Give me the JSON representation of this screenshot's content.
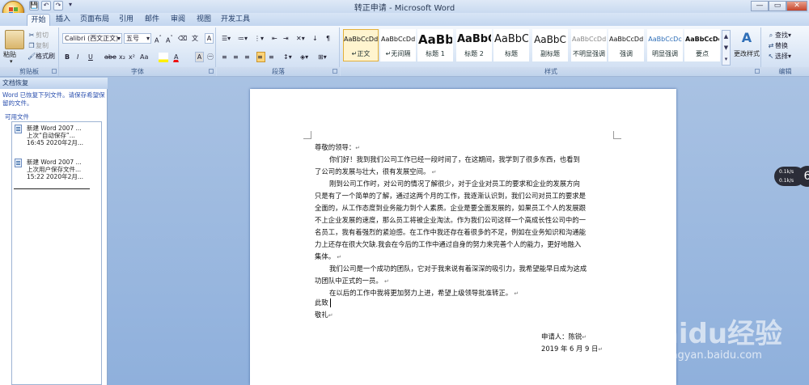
{
  "window": {
    "title": "转正申请 - Microsoft Word",
    "min": "—",
    "max": "▭",
    "close": "✕"
  },
  "qat": [
    "💾",
    "↶",
    "↷",
    "▾"
  ],
  "tabs": [
    "开始",
    "插入",
    "页面布局",
    "引用",
    "邮件",
    "审阅",
    "视图",
    "开发工具"
  ],
  "clipboard": {
    "paste": "粘贴",
    "cut": "剪切",
    "copy": "复制",
    "format_painter": "格式刷",
    "label": "剪贴板"
  },
  "font": {
    "name": "Calibri (西文正文)",
    "size": "五号",
    "label": "字体",
    "buttons": [
      "B",
      "I",
      "U",
      "abe",
      "x₂",
      "x²",
      "Aa",
      "A",
      "A"
    ]
  },
  "paragraph": {
    "label": "段落"
  },
  "styles": {
    "label": "样式",
    "items": [
      {
        "preview": "AaBbCcDd",
        "name": "↵正文",
        "size": "8px",
        "bold": false,
        "color": "#111"
      },
      {
        "preview": "AaBbCcDd",
        "name": "↵无间隔",
        "size": "8px",
        "bold": false,
        "color": "#111"
      },
      {
        "preview": "AaBb",
        "name": "标题 1",
        "size": "15px",
        "bold": true,
        "color": "#111"
      },
      {
        "preview": "AaBbC",
        "name": "标题 2",
        "size": "13px",
        "bold": true,
        "color": "#111"
      },
      {
        "preview": "AaBbC",
        "name": "标题",
        "size": "13px",
        "bold": false,
        "color": "#111"
      },
      {
        "preview": "AaBbC",
        "name": "副标题",
        "size": "12px",
        "bold": false,
        "color": "#111"
      },
      {
        "preview": "AaBbCcDd",
        "name": "不明显强调",
        "size": "8px",
        "bold": false,
        "color": "#888"
      },
      {
        "preview": "AaBbCcDd",
        "name": "强调",
        "size": "8px",
        "bold": false,
        "color": "#111"
      },
      {
        "preview": "AaBbCcDc",
        "name": "明显强调",
        "size": "8px",
        "bold": false,
        "color": "#2f6fb8"
      },
      {
        "preview": "AaBbCcDc",
        "name": "要点",
        "size": "8px",
        "bold": true,
        "color": "#111"
      }
    ],
    "change": "更改样式"
  },
  "editing": {
    "find": "查找",
    "replace": "替换",
    "select": "选择",
    "label": "编辑"
  },
  "recovery": {
    "title": "文档恢复",
    "message": "Word 已恢复下列文件。请保存希望保留的文件。",
    "available": "可用文件",
    "files": [
      {
        "name": "新建 Word 2007 ...",
        "desc": "上次“自动保存”...",
        "time": "16:45 2020年2月..."
      },
      {
        "name": "新建 Word 2007 ...",
        "desc": "上次用户保存文件...",
        "time": "15:22 2020年2月..."
      }
    ]
  },
  "document": {
    "greeting": "尊敬的领导：",
    "lines": [
      "你们好！我到我们公司工作已经一段时间了，在这期间，我学到了很多东西，也看到",
      "了公司的发展与壮大，很有发展空间。",
      "刚到公司工作时，对公司的情况了解很少，对于企业对员工的要求和企业的发展方向",
      "只是有了一个简单的了解，通过这两个月的工作，我逐渐认识到，我们公司对员工的要求是",
      "全面的，从工作态度到业务能力到个人素质。企业是要全面发展的，如果员工个人的发展跟",
      "不上企业发展的速度，那么员工将被企业淘汰。作为我们公司这样一个高成长性公司中的一",
      "名员工，我有着强烈的紧迫感。在工作中我还存在着很多的不足，例如在业务知识和沟通能",
      "力上还存在很大欠缺.我会在今后的工作中通过自身的努力来完善个人的能力，更好地融入",
      "集体。",
      "我们公司是一个成功的团队，它对于我来说有着深深的吸引力，我希望能早日成为这成",
      "功团队中正式的一员。",
      "在以后的工作中我将更加努力上进，希望上级领导批准转正。"
    ],
    "closing1": "此致",
    "closing2": "敬礼",
    "applicant": "申请人：陈锐",
    "date": "2019 年 6 月 9 日"
  },
  "perf": {
    "up": "0.1k/s",
    "down": "0.1k/s",
    "value": "6"
  },
  "watermark": {
    "brand": "Baidu经验",
    "url": "jingyan.baidu.com"
  }
}
